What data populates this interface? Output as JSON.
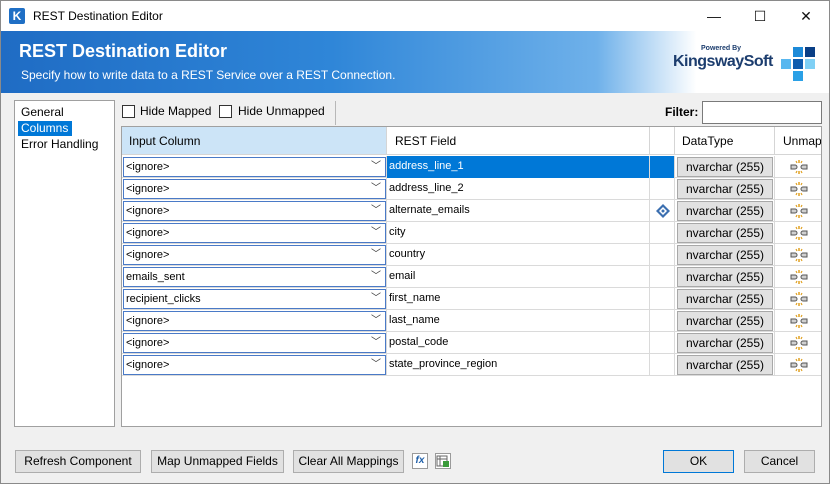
{
  "window": {
    "title": "REST Destination Editor",
    "minimize_glyph": "—",
    "maximize_glyph": "☐",
    "close_glyph": "✕",
    "icon_letter": "K"
  },
  "banner": {
    "title": "REST Destination Editor",
    "subtitle": "Specify how to write data to a REST Service over a REST Connection.",
    "brand_prefix": "Powered By",
    "brand_name": "KingswaySoft"
  },
  "nav": {
    "items": [
      {
        "label": "General",
        "selected": false
      },
      {
        "label": "Columns",
        "selected": true
      },
      {
        "label": "Error Handling",
        "selected": false
      }
    ]
  },
  "toolbar": {
    "hide_mapped_label": "Hide Mapped",
    "hide_unmapped_label": "Hide Unmapped",
    "filter_label": "Filter:",
    "filter_value": ""
  },
  "grid": {
    "headers": {
      "input_column": "Input Column",
      "rest_field": "REST Field",
      "data_type": "DataType",
      "unmap": "Unmap"
    },
    "chevron": "﹀",
    "rows": [
      {
        "input": "<ignore>",
        "field": "address_line_1",
        "data_type": "nvarchar (255)",
        "selected": true
      },
      {
        "input": "<ignore>",
        "field": "address_line_2",
        "data_type": "nvarchar (255)"
      },
      {
        "input": "<ignore>",
        "field": "alternate_emails",
        "data_type": "nvarchar (255)",
        "has_icon": true
      },
      {
        "input": "<ignore>",
        "field": "city",
        "data_type": "nvarchar (255)"
      },
      {
        "input": "<ignore>",
        "field": "country",
        "data_type": "nvarchar (255)"
      },
      {
        "input": "emails_sent",
        "field": "email",
        "data_type": "nvarchar (255)"
      },
      {
        "input": "recipient_clicks",
        "field": "first_name",
        "data_type": "nvarchar (255)"
      },
      {
        "input": "<ignore>",
        "field": "last_name",
        "data_type": "nvarchar (255)"
      },
      {
        "input": "<ignore>",
        "field": "postal_code",
        "data_type": "nvarchar (255)"
      },
      {
        "input": "<ignore>",
        "field": "state_province_region",
        "data_type": "nvarchar (255)"
      }
    ]
  },
  "buttons": {
    "refresh": "Refresh Component",
    "map_unmapped": "Map Unmapped Fields",
    "clear_all": "Clear All Mappings",
    "expression_icon_glyph": "fx",
    "ok": "OK",
    "cancel": "Cancel"
  },
  "colors": {
    "accent": "#0078d7",
    "banner_blue": "#1f6cc4",
    "header_highlight": "#cce4f7",
    "brand_text": "#1c3d6e"
  }
}
